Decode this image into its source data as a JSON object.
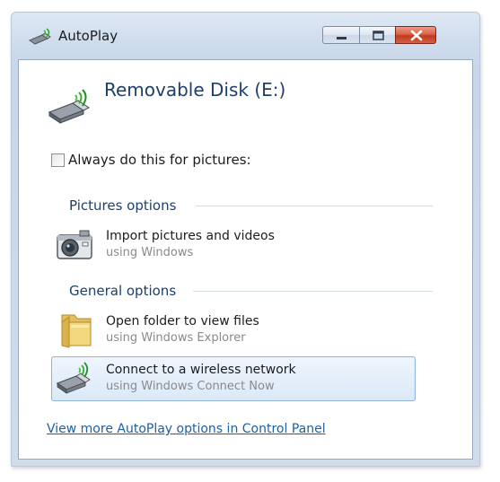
{
  "window": {
    "title": "AutoPlay",
    "buttons": {
      "minimize": "minimize-icon",
      "maximize": "maximize-icon",
      "close": "close-icon"
    }
  },
  "device": {
    "name": "Removable Disk (E:)",
    "icon": "usb-wireless-device-icon"
  },
  "always": {
    "label": "Always do this for pictures:",
    "checked": false
  },
  "groups": [
    {
      "label": "Pictures options",
      "options": [
        {
          "title": "Import pictures and videos",
          "subtitle": "using Windows",
          "icon": "camera-icon",
          "selected": false
        }
      ]
    },
    {
      "label": "General options",
      "options": [
        {
          "title": "Open folder to view files",
          "subtitle": "using Windows Explorer",
          "icon": "folder-icon",
          "selected": false
        },
        {
          "title": "Connect to a wireless network",
          "subtitle": "using Windows Connect Now",
          "icon": "usb-wireless-device-icon",
          "selected": true
        }
      ]
    }
  ],
  "footer": {
    "link": "View more AutoPlay options in Control Panel"
  },
  "colors": {
    "heading": "#1e3f6b",
    "link": "#1a5fa8",
    "subtext": "#8a8a8a",
    "selection": "#dbe9f8"
  }
}
